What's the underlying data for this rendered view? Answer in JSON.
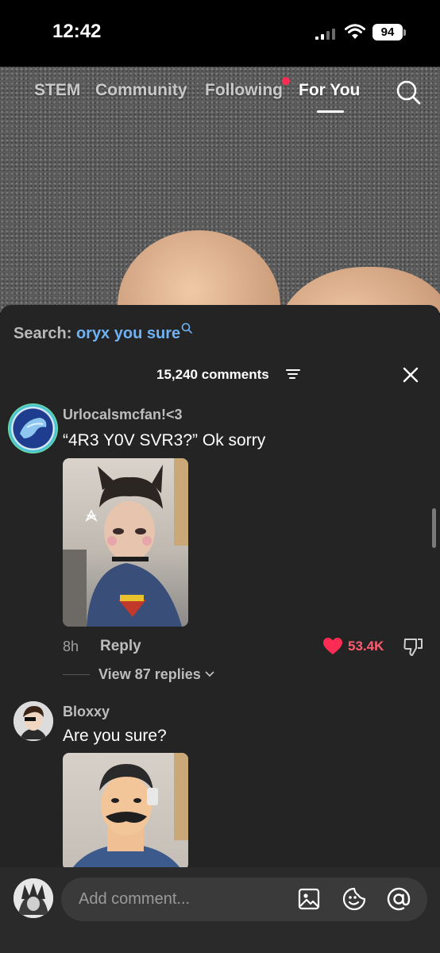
{
  "status_bar": {
    "time": "12:42",
    "battery": "94",
    "icons": [
      "signal-icon",
      "wifi-icon",
      "battery-icon"
    ]
  },
  "top_nav": {
    "tabs": [
      "STEM",
      "Community",
      "Following",
      "For You"
    ],
    "active_tab": "For You",
    "icons": [
      "search-icon"
    ]
  },
  "comments_sheet": {
    "search_prefix": "Search:",
    "search_query": "oryx you sure",
    "count_label": "15,240 comments",
    "comments": [
      {
        "username": "Urlocalsmcfan!<3",
        "text": "“4R3 Y0V SVR3?” Ok sorry",
        "time": "8h",
        "reply_label": "Reply",
        "likes": "53.4K",
        "view_replies": "View 87 replies"
      },
      {
        "username": "Bloxxy",
        "text": "Are you sure?"
      }
    ]
  },
  "bottom_bar": {
    "placeholder": "Add comment...",
    "icons": [
      "image-icon",
      "emoji-icon",
      "mention-icon"
    ]
  },
  "colors": {
    "accent_like": "#fe2c55",
    "search_query": "#6fb3f5",
    "sheet_bg": "#242424"
  }
}
